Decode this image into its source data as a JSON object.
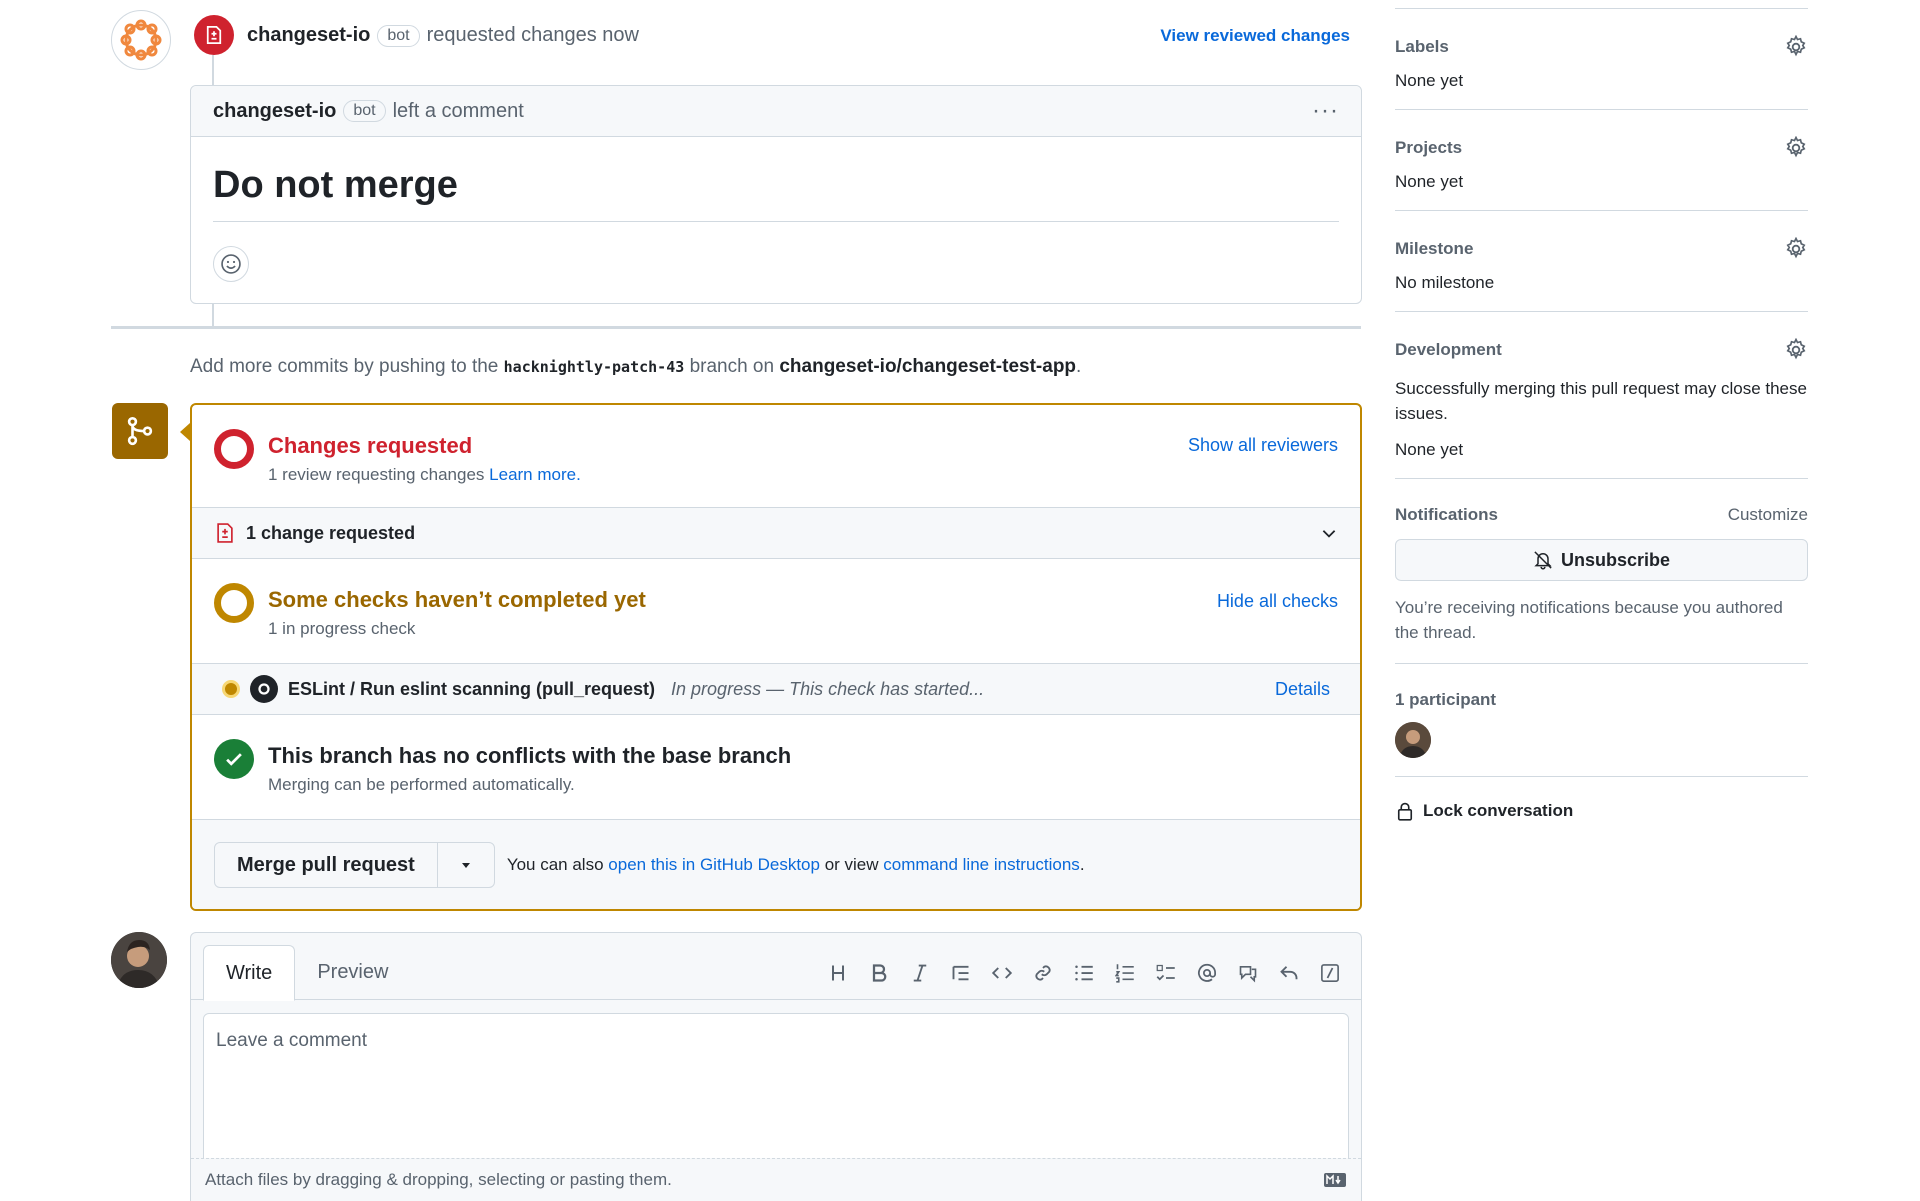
{
  "timeline": {
    "review_event": {
      "author": "changeset-io",
      "badge": "bot",
      "action": "requested changes now",
      "view_link": "View reviewed changes"
    },
    "comment": {
      "author": "changeset-io",
      "badge": "bot",
      "action": "left a comment",
      "more": "···",
      "title": "Do not merge"
    },
    "push_hint": {
      "prefix": "Add more commits by pushing to the",
      "branch": "hacknightly-patch-43",
      "middle": "branch on",
      "repo": "changeset-io/changeset-test-app",
      "suffix": "."
    }
  },
  "merge_box": {
    "changes": {
      "title": "Changes requested",
      "subtitle": "1 review requesting changes",
      "learn_more": "Learn more.",
      "link": "Show all reviewers",
      "row_label": "1 change requested"
    },
    "checks": {
      "title": "Some checks haven’t completed yet",
      "subtitle": "1 in progress check",
      "link": "Hide all checks",
      "row_name": "ESLint / Run eslint scanning (pull_request)",
      "row_status": "In progress — This check has started...",
      "row_link": "Details"
    },
    "conflicts": {
      "title": "This branch has no conflicts with the base branch",
      "subtitle": "Merging can be performed automatically."
    },
    "footer": {
      "merge_button": "Merge pull request",
      "also_text": "You can also",
      "desktop_link": "open this in GitHub Desktop",
      "or_view": "or view",
      "cli_link": "command line instructions",
      "period": "."
    },
    "colors": {
      "warning_border": "#bf8700",
      "danger": "#cf222e",
      "attention": "#9a6700",
      "success": "#1a7f37"
    }
  },
  "editor": {
    "tab_write": "Write",
    "tab_preview": "Preview",
    "placeholder": "Leave a comment",
    "attach_text": "Attach files by dragging & dropping, selecting or pasting them.",
    "toolbar_icons": [
      "heading-icon",
      "bold-icon",
      "italic-icon",
      "quote-icon",
      "code-icon",
      "link-icon",
      "bulleted-list-icon",
      "numbered-list-icon",
      "task-list-icon",
      "mention-icon",
      "cross-reference-icon",
      "reply-icon",
      "slash-command-icon"
    ]
  },
  "sidebar": {
    "labels": {
      "heading": "Labels",
      "value": "None yet"
    },
    "projects": {
      "heading": "Projects",
      "value": "None yet"
    },
    "milestone": {
      "heading": "Milestone",
      "value": "No milestone"
    },
    "development": {
      "heading": "Development",
      "description": "Successfully merging this pull request may close these issues.",
      "value": "None yet"
    },
    "notifications": {
      "heading": "Notifications",
      "customize": "Customize",
      "button": "Unsubscribe",
      "reason": "You’re receiving notifications because you authored the thread."
    },
    "participants": {
      "heading": "1 participant"
    },
    "lock": "Lock conversation"
  }
}
